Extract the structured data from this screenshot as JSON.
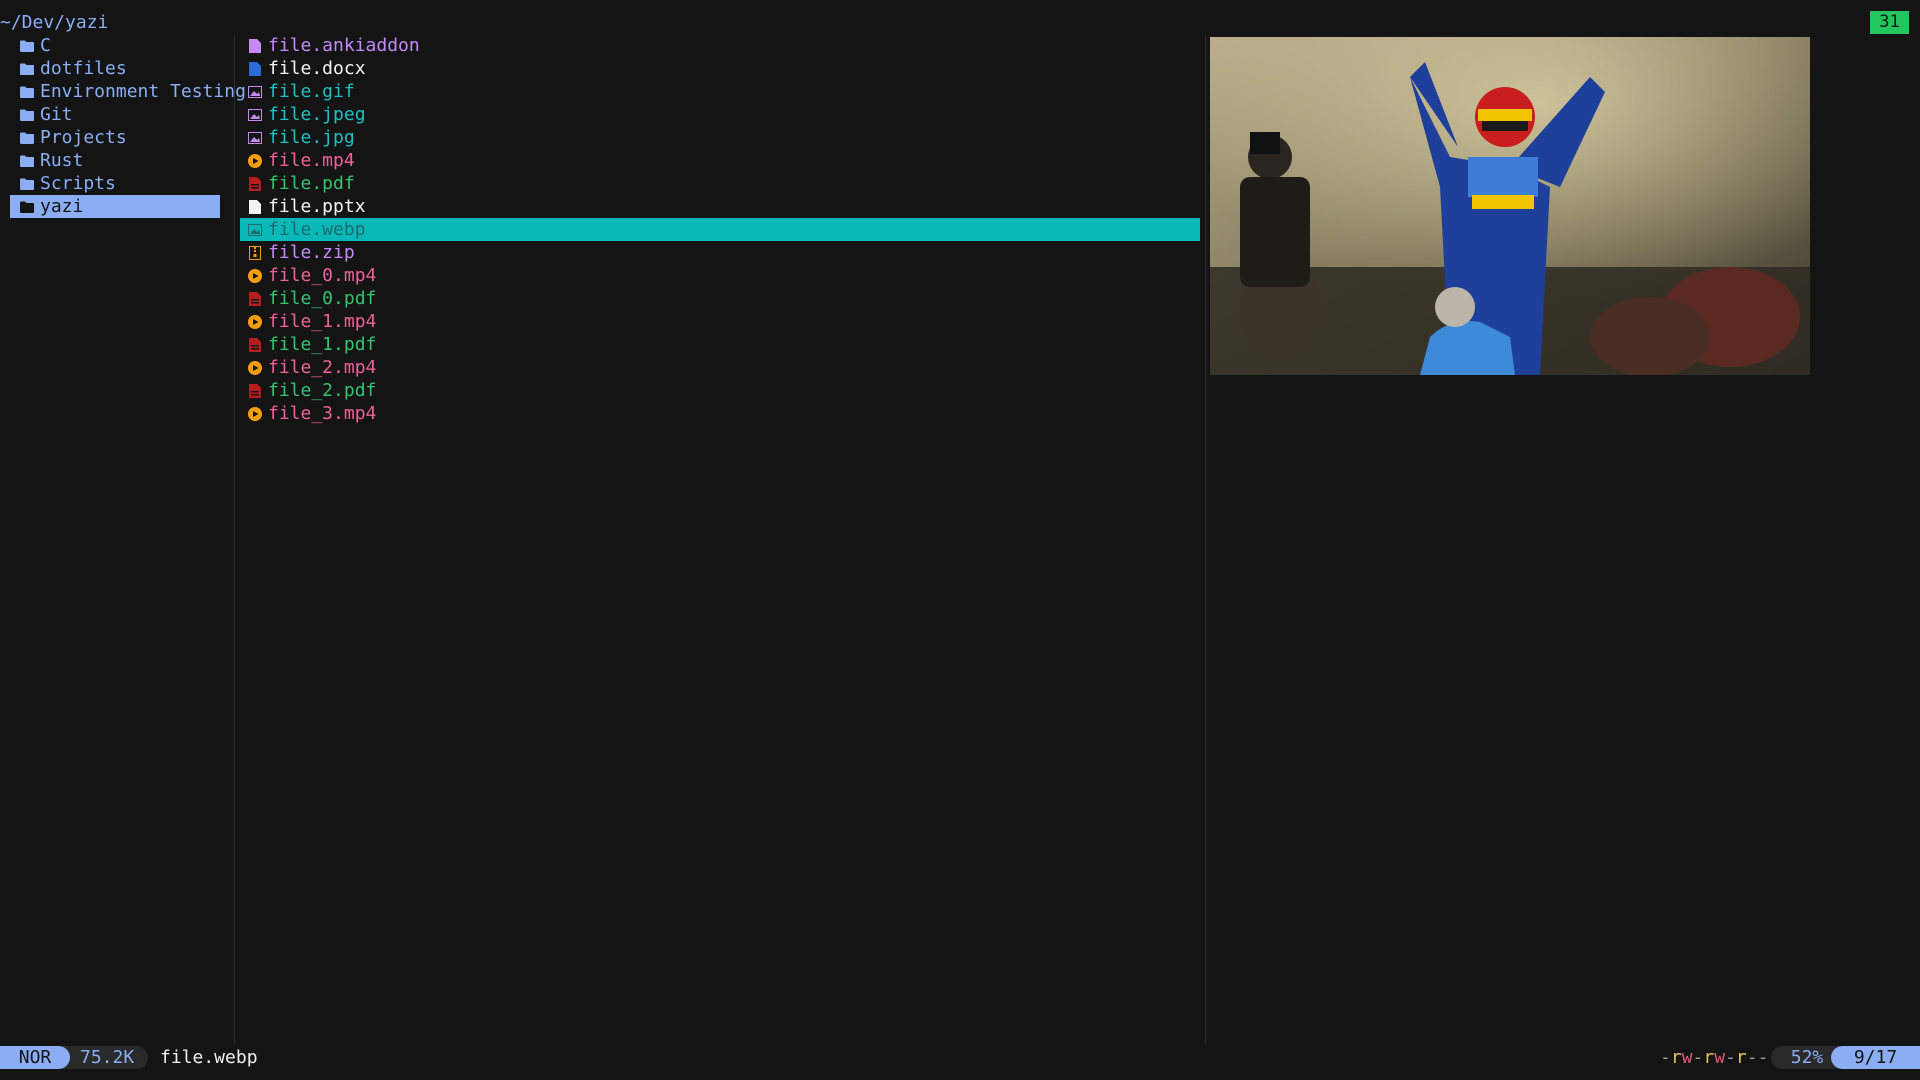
{
  "header": {
    "cwd": "~/Dev/yazi",
    "tab_count": "31"
  },
  "parent_dir": {
    "items": [
      {
        "name": "C"
      },
      {
        "name": "dotfiles"
      },
      {
        "name": "Environment Testing"
      },
      {
        "name": "Git"
      },
      {
        "name": "Projects"
      },
      {
        "name": "Rust"
      },
      {
        "name": "Scripts"
      },
      {
        "name": "yazi",
        "selected": true
      }
    ]
  },
  "current_dir": {
    "items": [
      {
        "name": "file.ankiaddon",
        "icon": "document-icon",
        "color": "#c58af9"
      },
      {
        "name": "file.docx",
        "icon": "word-document-icon",
        "color": "#f4f4f4"
      },
      {
        "name": "file.gif",
        "icon": "image-icon",
        "color": "#17c3c3"
      },
      {
        "name": "file.jpeg",
        "icon": "image-icon",
        "color": "#17c3c3"
      },
      {
        "name": "file.jpg",
        "icon": "image-icon",
        "color": "#17c3c3"
      },
      {
        "name": "file.mp4",
        "icon": "video-icon",
        "color": "#f0609a"
      },
      {
        "name": "file.pdf",
        "icon": "pdf-icon",
        "color": "#33c470"
      },
      {
        "name": "file.pptx",
        "icon": "document-icon",
        "color": "#f4f4f4"
      },
      {
        "name": "file.webp",
        "icon": "image-icon",
        "color": "#17c3c3",
        "hovered": true
      },
      {
        "name": "file.zip",
        "icon": "archive-icon",
        "color": "#c58af9"
      },
      {
        "name": "file_0.mp4",
        "icon": "video-icon",
        "color": "#f0609a"
      },
      {
        "name": "file_0.pdf",
        "icon": "pdf-icon",
        "color": "#33c470"
      },
      {
        "name": "file_1.mp4",
        "icon": "video-icon",
        "color": "#f0609a"
      },
      {
        "name": "file_1.pdf",
        "icon": "pdf-icon",
        "color": "#33c470"
      },
      {
        "name": "file_2.mp4",
        "icon": "video-icon",
        "color": "#f0609a"
      },
      {
        "name": "file_2.pdf",
        "icon": "pdf-icon",
        "color": "#33c470"
      },
      {
        "name": "file_3.mp4",
        "icon": "video-icon",
        "color": "#f0609a"
      }
    ]
  },
  "status": {
    "mode": "NOR",
    "size": "75.2K",
    "filename": "file.webp",
    "permissions": "-rw-rw-r--",
    "percent": "52%",
    "position": "9/17"
  },
  "colors": {
    "accent": "#8aadf4",
    "hover": "#09b9b9",
    "tab_badge": "#22c55e"
  }
}
